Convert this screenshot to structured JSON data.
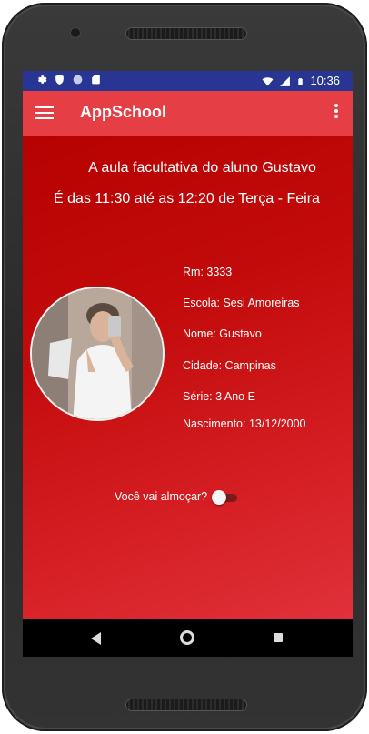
{
  "statusbar": {
    "icons_left": [
      "settings-icon",
      "shield-icon",
      "circle-icon",
      "sd-card-icon"
    ],
    "icons_right": [
      "wifi-icon",
      "signal-icon",
      "battery-icon"
    ],
    "time": "10:36"
  },
  "appbar": {
    "title": "AppSchool",
    "menu_icon": "hamburger-menu-icon",
    "overflow_icon": "more-vert-icon"
  },
  "main": {
    "headline1": "A aula facultativa do aluno Gustavo",
    "headline2": "É das 11:30 até as 12:20 de Terça - Feira",
    "student": {
      "rm": "Rm: 3333",
      "escola": "Escola: Sesi Amoreiras",
      "nome": "Nome: Gustavo",
      "cidade": "Cidade: Campinas",
      "serie": "Série: 3 Ano E",
      "nascimento": "Nascimento: 13/12/2000"
    },
    "lunch_question": "Você vai almoçar?",
    "lunch_switch_on": false,
    "fab_icon": "exit-to-app-icon"
  },
  "colors": {
    "statusbar": "#283593",
    "appbar": "#e53e45",
    "background": "#c20a0a",
    "fab": "#1a9bd7"
  }
}
